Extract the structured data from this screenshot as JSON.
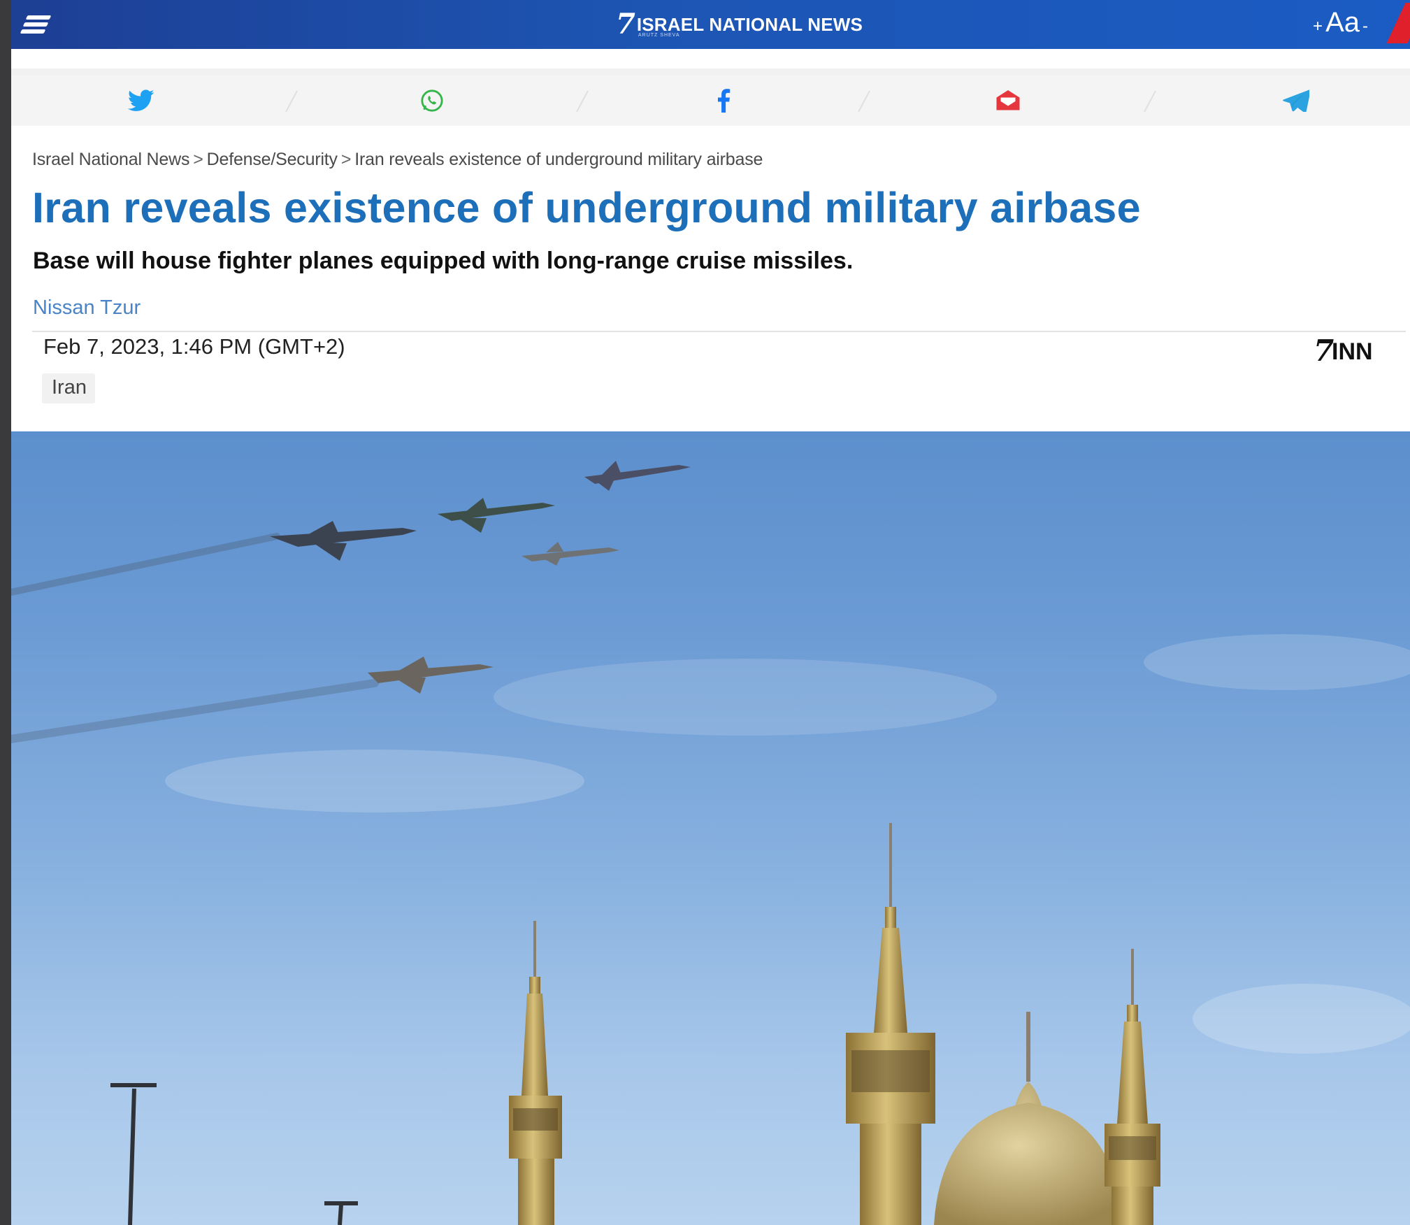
{
  "header": {
    "site_name": "ISRAEL NATIONAL NEWS",
    "logo_sub": "ARUTZ SHEVA",
    "font_plus": "+",
    "font_label": "Aa",
    "font_minus": "-"
  },
  "share": {
    "items": [
      "twitter-icon",
      "whatsapp-icon",
      "facebook-icon",
      "email-icon",
      "telegram-icon"
    ]
  },
  "breadcrumb": {
    "items": [
      "Israel National News",
      "Defense/Security",
      "Iran reveals existence of underground military airbase"
    ],
    "separator": ">"
  },
  "article": {
    "title": "Iran reveals existence of underground military airbase",
    "subtitle": "Base will house fighter planes equipped with long-range cruise missiles.",
    "author": "Nissan Tzur",
    "date": "Feb 7, 2023, 1:46 PM (GMT+2)",
    "tag": "Iran",
    "brand_mark": "INN"
  },
  "colors": {
    "header_blue": "#1d55b3",
    "title_blue": "#1c6fb8",
    "author_blue": "#4a84c6",
    "accent_red": "#e0202a"
  }
}
